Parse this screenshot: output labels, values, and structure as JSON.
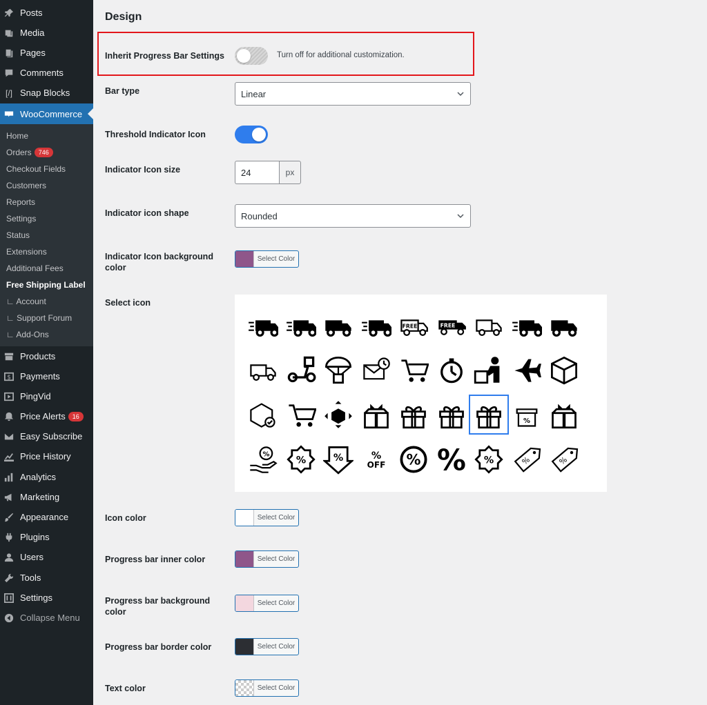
{
  "sidebar": {
    "top_items": [
      {
        "label": "Posts",
        "icon": "pushpin-icon"
      },
      {
        "label": "Media",
        "icon": "media-icon"
      },
      {
        "label": "Pages",
        "icon": "pages-icon"
      },
      {
        "label": "Comments",
        "icon": "comment-icon"
      },
      {
        "label": "Snap Blocks",
        "icon": "brackets-icon"
      },
      {
        "label": "WooCommerce",
        "icon": "woo-icon"
      }
    ],
    "sub_items": [
      {
        "label": "Home"
      },
      {
        "label": "Orders",
        "badge": "746"
      },
      {
        "label": "Checkout Fields"
      },
      {
        "label": "Customers"
      },
      {
        "label": "Reports"
      },
      {
        "label": "Settings"
      },
      {
        "label": "Status"
      },
      {
        "label": "Extensions"
      },
      {
        "label": "Additional Fees"
      },
      {
        "label": "Free Shipping Label"
      },
      {
        "label": "∟ Account"
      },
      {
        "label": "∟ Support Forum"
      },
      {
        "label": "∟ Add-Ons"
      }
    ],
    "bottom_items": [
      {
        "label": "Products",
        "icon": "archive-icon"
      },
      {
        "label": "Payments",
        "icon": "dollar-icon"
      },
      {
        "label": "PingVid",
        "icon": "video-icon"
      },
      {
        "label": "Price Alerts",
        "icon": "bell-icon",
        "badge": "16"
      },
      {
        "label": "Easy Subscribe",
        "icon": "envelope-icon"
      },
      {
        "label": "Price History",
        "icon": "line-chart-icon"
      },
      {
        "label": "Analytics",
        "icon": "bar-chart-icon"
      },
      {
        "label": "Marketing",
        "icon": "megaphone-icon"
      },
      {
        "label": "Appearance",
        "icon": "brush-icon"
      },
      {
        "label": "Plugins",
        "icon": "plug-icon"
      },
      {
        "label": "Users",
        "icon": "user-icon"
      },
      {
        "label": "Tools",
        "icon": "wrench-icon"
      },
      {
        "label": "Settings",
        "icon": "sliders-icon"
      }
    ],
    "collapse_label": "Collapse Menu",
    "accent": "#2271b1",
    "bg": "#1d2327"
  },
  "design": {
    "title": "Design",
    "inherit": {
      "label": "Inherit Progress Bar Settings",
      "enabled": false,
      "hint": "Turn off for additional customization."
    },
    "bar_type": {
      "label": "Bar type",
      "value": "Linear"
    },
    "threshold_icon": {
      "label": "Threshold Indicator Icon",
      "enabled": true
    },
    "icon_size": {
      "label": "Indicator Icon size",
      "value": "24",
      "unit": "px"
    },
    "icon_shape": {
      "label": "Indicator icon shape",
      "value": "Rounded"
    },
    "icon_bg_color": {
      "label": "Indicator Icon background color",
      "button": "Select Color",
      "color": "#8f568a"
    },
    "select_icon": {
      "label": "Select icon",
      "selected_index": 24,
      "icons": [
        "delivery-truck-icon",
        "fast-truck-icon",
        "truck-icon",
        "speed-truck-icon",
        "free-gift-truck-icon",
        "free-delivery-truck-icon",
        "scheduled-truck-icon",
        "express-truck-icon",
        "moving-truck-icon",
        "delivered-truck-icon",
        "scooter-delivery-icon",
        "parachute-box-icon",
        "timed-mail-icon",
        "shopping-cart-icon",
        "fast-stopwatch-icon",
        "delivery-person-icon",
        "airplane-icon",
        "package-icon",
        "verified-box-icon",
        "free-cart-icon",
        "expand-box-icon",
        "gift-box-bow-icon",
        "gift-outline-icon",
        "gift-ribbon-icon",
        "gift-box-icon",
        "discount-gift-icon",
        "gift-large-icon",
        "discount-hand-icon",
        "discount-gear-icon",
        "discount-arrow-icon",
        "percent-off-icon",
        "percent-circle-icon",
        "percent-icon",
        "discount-badge-icon",
        "price-tag-outline-icon",
        "price-tag-icon"
      ]
    },
    "icon_color": {
      "label": "Icon color",
      "button": "Select Color",
      "color": "#ffffff"
    },
    "inner_color": {
      "label": "Progress bar inner color",
      "button": "Select Color",
      "color": "#8f568a"
    },
    "bg_color": {
      "label": "Progress bar background color",
      "button": "Select Color",
      "color": "#f3d7df"
    },
    "border_color": {
      "label": "Progress bar border color",
      "button": "Select Color",
      "color": "#2c2e33"
    },
    "text_color": {
      "label": "Text color",
      "button": "Select Color",
      "color": "transparent"
    },
    "toggle_on_color": "#2f7ded",
    "highlight_color": "#e3161b"
  }
}
